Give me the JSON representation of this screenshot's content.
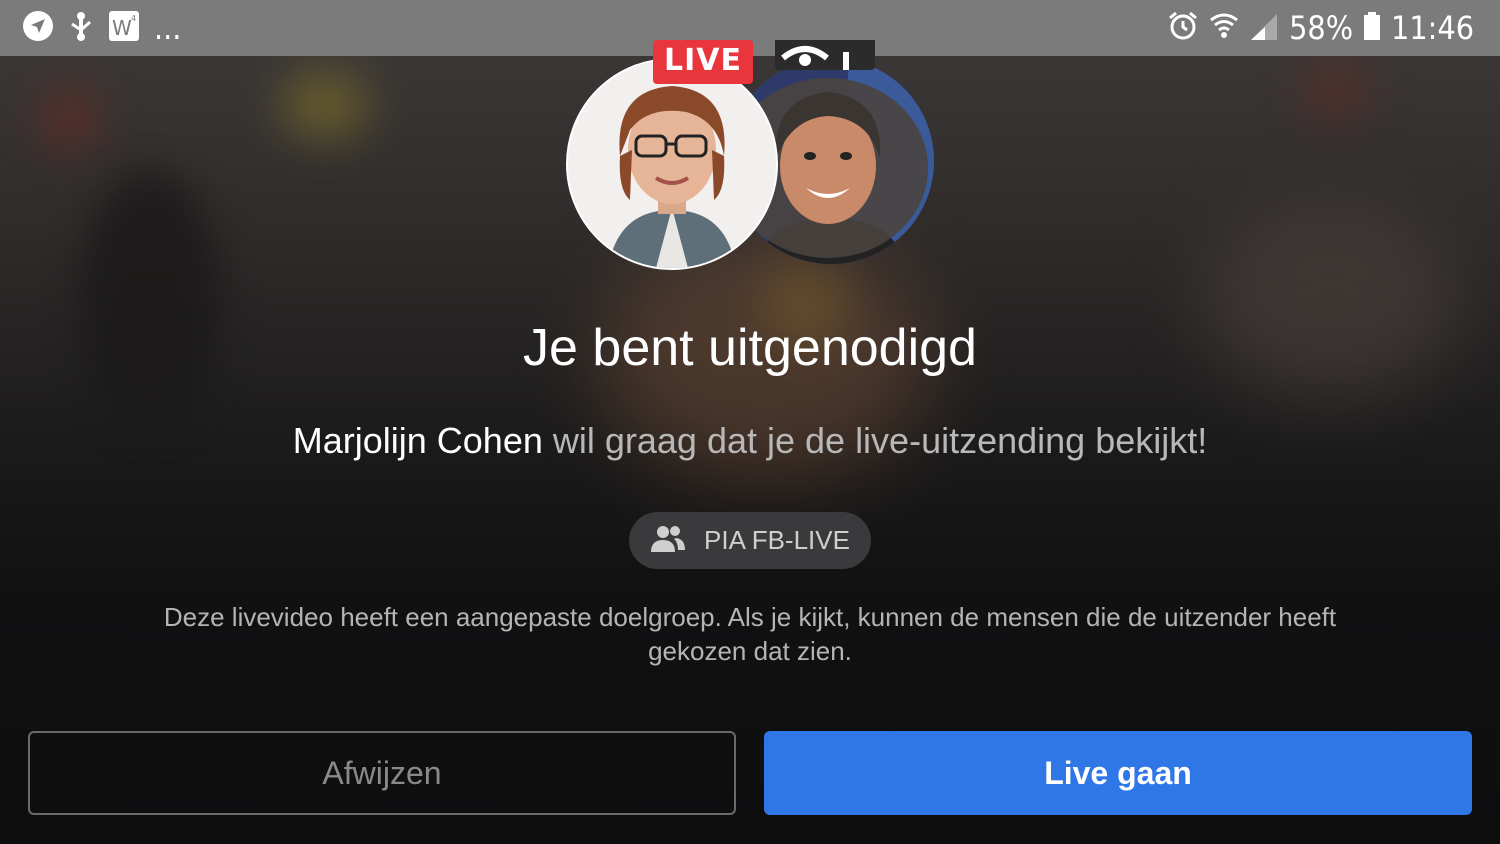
{
  "status_bar": {
    "icons_left": [
      "navigation-icon",
      "usb-debug-icon",
      "word-app-icon",
      "more-notifications-icon"
    ],
    "more_label": "...",
    "icons_right": [
      "alarm-icon",
      "wifi-icon",
      "signal-icon",
      "battery-icon"
    ],
    "battery": "58%",
    "time": "11:46"
  },
  "header": {
    "live_badge": "LIVE"
  },
  "dialog": {
    "title": "Je bent uitgenodigd",
    "inviter_name": "Marjolijn Cohen",
    "invite_text": " wil graag dat je de live-uitzending bekijkt!",
    "audience_label": "PIA FB-LIVE",
    "notice": "Deze livevideo heeft een aangepaste doelgroep. Als je kijkt, kunnen de mensen die de uitzender heeft gekozen dat zien."
  },
  "buttons": {
    "decline": "Afwijzen",
    "go_live": "Live gaan"
  },
  "colors": {
    "accent": "#2f77e6",
    "live_red": "#e9353c",
    "status_bar": "#7b7b7b"
  }
}
